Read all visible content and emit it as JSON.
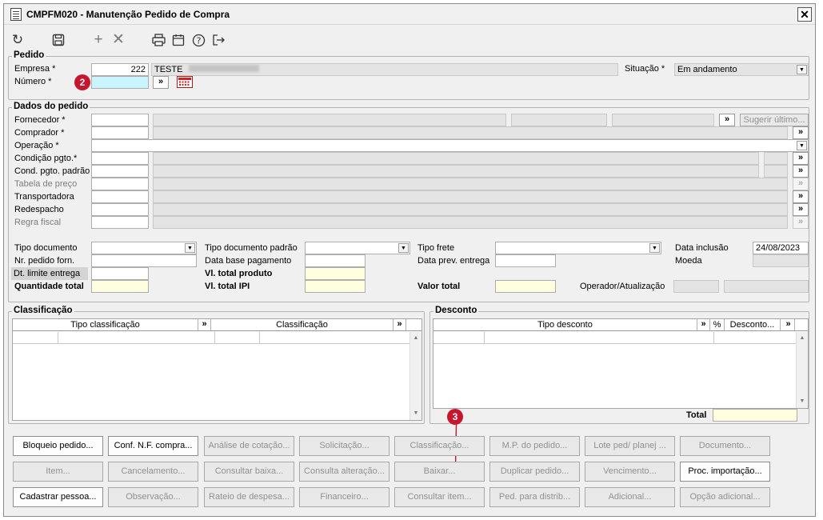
{
  "window": {
    "title": "CMPFM020 - Manutenção Pedido de Compra",
    "close_label": "✕"
  },
  "toolbar": {
    "icons": [
      "refresh-icon",
      "save-icon",
      "add-icon",
      "delete-icon",
      "print-icon",
      "calendar-icon",
      "help-icon",
      "exit-icon"
    ]
  },
  "pedido": {
    "legend": "Pedido",
    "empresa_label": "Empresa *",
    "empresa_code": "222",
    "empresa_name": "TESTE",
    "numero_label": "Número *",
    "numero_value": "",
    "situacao_label": "Situação *",
    "situacao_value": "Em andamento",
    "badge": "2"
  },
  "dados": {
    "legend": "Dados do pedido",
    "labels": {
      "fornecedor": "Fornecedor *",
      "comprador": "Comprador *",
      "operacao": "Operação *",
      "condicao": "Condição pgto.*",
      "cond_padrao": "Cond. pgto. padrão",
      "tabela": "Tabela de preço",
      "transportadora": "Transportadora",
      "redespacho": "Redespacho",
      "regra": "Regra fiscal"
    },
    "sugerir_label": "Sugerir último...",
    "tipo_documento_label": "Tipo documento",
    "tipo_documento_padrao_label": "Tipo documento padrão",
    "tipo_frete_label": "Tipo frete",
    "data_inclusao_label": "Data inclusão",
    "data_inclusao_value": "24/08/2023",
    "nr_pedido_forn_label": "Nr. pedido forn.",
    "data_base_pagamento_label": "Data base pagamento",
    "data_prev_entrega_label": "Data prev. entrega",
    "moeda_label": "Moeda",
    "dt_limite_entrega_label": "Dt. limite entrega",
    "vl_total_produto_label": "Vl. total produto",
    "quantidade_total_label": "Quantidade total",
    "vl_total_ipi_label": "Vl. total IPI",
    "valor_total_label": "Valor total",
    "operador_label": "Operador/Atualização"
  },
  "classificacao": {
    "legend": "Classificação",
    "col1": "Tipo classificação",
    "col2": "Classificação",
    "expand": "»"
  },
  "desconto": {
    "legend": "Desconto",
    "col1": "Tipo desconto",
    "col2": "%",
    "col3": "Desconto...",
    "expand": "»",
    "total_label": "Total",
    "badge": "3"
  },
  "buttons": {
    "row1": [
      {
        "label": "Bloqueio pedido...",
        "enabled": true
      },
      {
        "label": "Conf. N.F. compra...",
        "enabled": true
      },
      {
        "label": "Análise de cotação...",
        "enabled": false
      },
      {
        "label": "Solicitação...",
        "enabled": false
      },
      {
        "label": "Classificação...",
        "enabled": false
      },
      {
        "label": "M.P. do pedido...",
        "enabled": false
      },
      {
        "label": "Lote ped/ planej ...",
        "enabled": false
      },
      {
        "label": "Documento...",
        "enabled": false
      }
    ],
    "row2": [
      {
        "label": "Item...",
        "enabled": false
      },
      {
        "label": "Cancelamento...",
        "enabled": false
      },
      {
        "label": "Consultar baixa...",
        "enabled": false
      },
      {
        "label": "Consulta alteração...",
        "enabled": false
      },
      {
        "label": "Baixar...",
        "enabled": false
      },
      {
        "label": "Duplicar pedido...",
        "enabled": false
      },
      {
        "label": "Vencimento...",
        "enabled": false
      },
      {
        "label": "Proc. importação...",
        "enabled": true
      }
    ],
    "row3": [
      {
        "label": "Cadastrar pessoa...",
        "enabled": true
      },
      {
        "label": "Observação...",
        "enabled": false
      },
      {
        "label": "Rateio de despesa...",
        "enabled": false
      },
      {
        "label": "Financeiro...",
        "enabled": false
      },
      {
        "label": "Consultar item...",
        "enabled": false
      },
      {
        "label": "Ped. para distrib...",
        "enabled": false
      },
      {
        "label": "Adicional...",
        "enabled": false
      },
      {
        "label": "Opção adicional...",
        "enabled": false
      }
    ]
  },
  "colors": {
    "badge": "#c6172e",
    "required_field": "#c8f5ff",
    "total_field": "#ffffe0",
    "arrow": "#c6172e"
  }
}
